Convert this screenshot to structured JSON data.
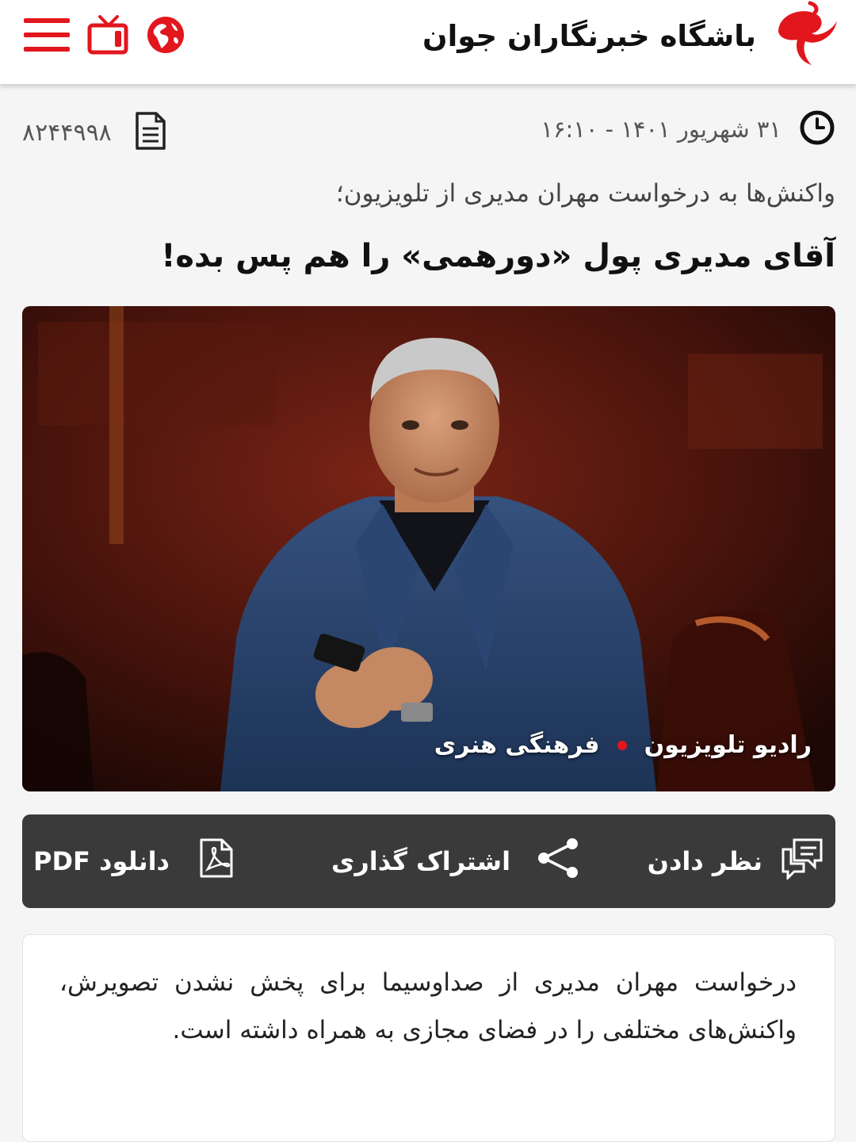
{
  "header": {
    "title": "باشگاه خبرنگاران جوان",
    "brand_color": "#e2161d",
    "icons": [
      "menu-icon",
      "tv-icon",
      "globe-icon"
    ]
  },
  "meta": {
    "date": "۳۱ شهریور ۱۴۰۱ - ۱۶:۱۰",
    "news_code": "۸۲۴۴۹۹۸"
  },
  "article": {
    "lead": "واکنش‌ها به درخواست مهران مدیری از تلویزیون؛",
    "headline": "آقای مدیری پول «دورهمی» را هم پس بده!",
    "category": "فرهنگی هنری",
    "subcategory": "رادیو تلویزیون",
    "body": "درخواست مهران مدیری از صداوسیما برای پخش نشدن تصویرش، واکنش‌های مختلفی را در فضای مجازی به همراه داشته است."
  },
  "actions": {
    "comment": "نظر دادن",
    "share": "اشتراک گذاری",
    "pdf": "دانلود PDF"
  }
}
